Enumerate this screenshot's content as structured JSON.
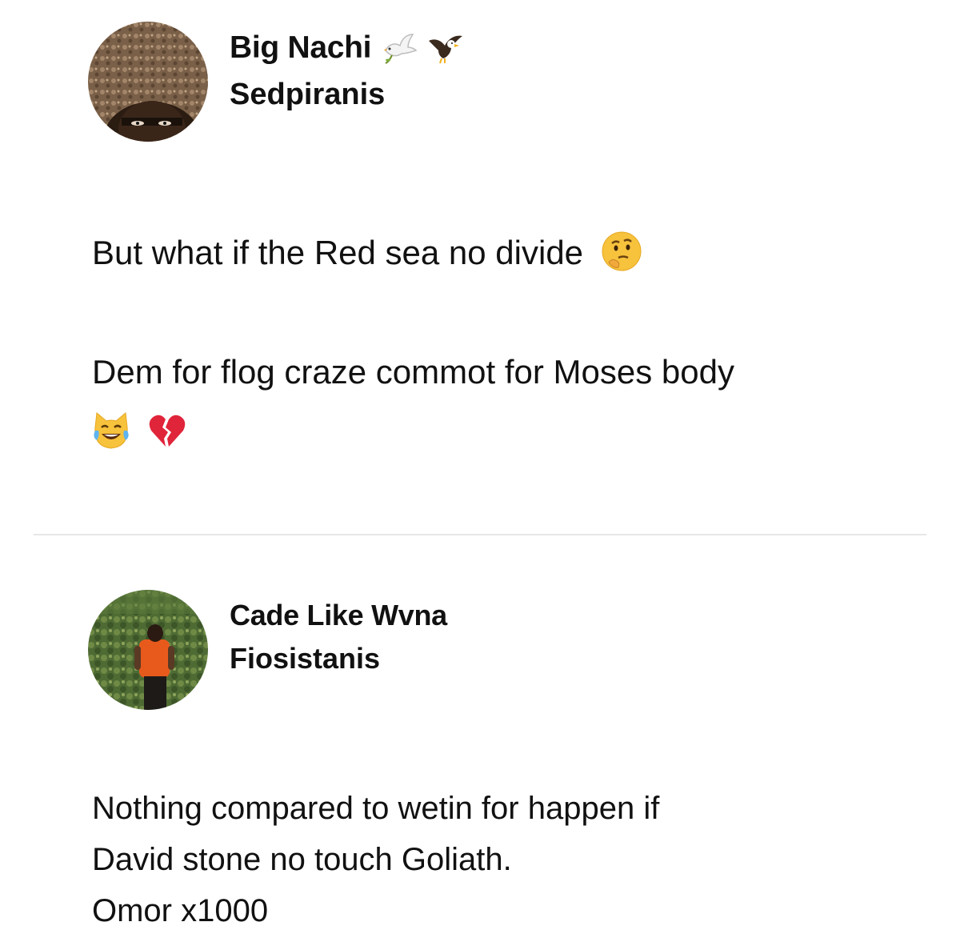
{
  "posts": [
    {
      "author_name": "Big Nachi",
      "name_emojis": [
        "dove-icon",
        "eagle-icon"
      ],
      "location": "Sedpiranis",
      "text_lines": [
        "But what if the Red sea no divide",
        "Dem for flog craze commot for Moses body"
      ],
      "emojis": [
        "thinking-face-icon",
        "cat-with-tears-of-joy-icon",
        "broken-heart-icon"
      ]
    },
    {
      "author_name": "Cade Like Wvna",
      "location": "Fiosistanis",
      "text_lines": [
        "Nothing compared to wetin for happen if",
        "David stone no touch Goliath.",
        "Omor x1000"
      ]
    }
  ],
  "colors": {
    "background": "#ffffff",
    "text": "#111111",
    "divider": "#e6e6e6"
  }
}
